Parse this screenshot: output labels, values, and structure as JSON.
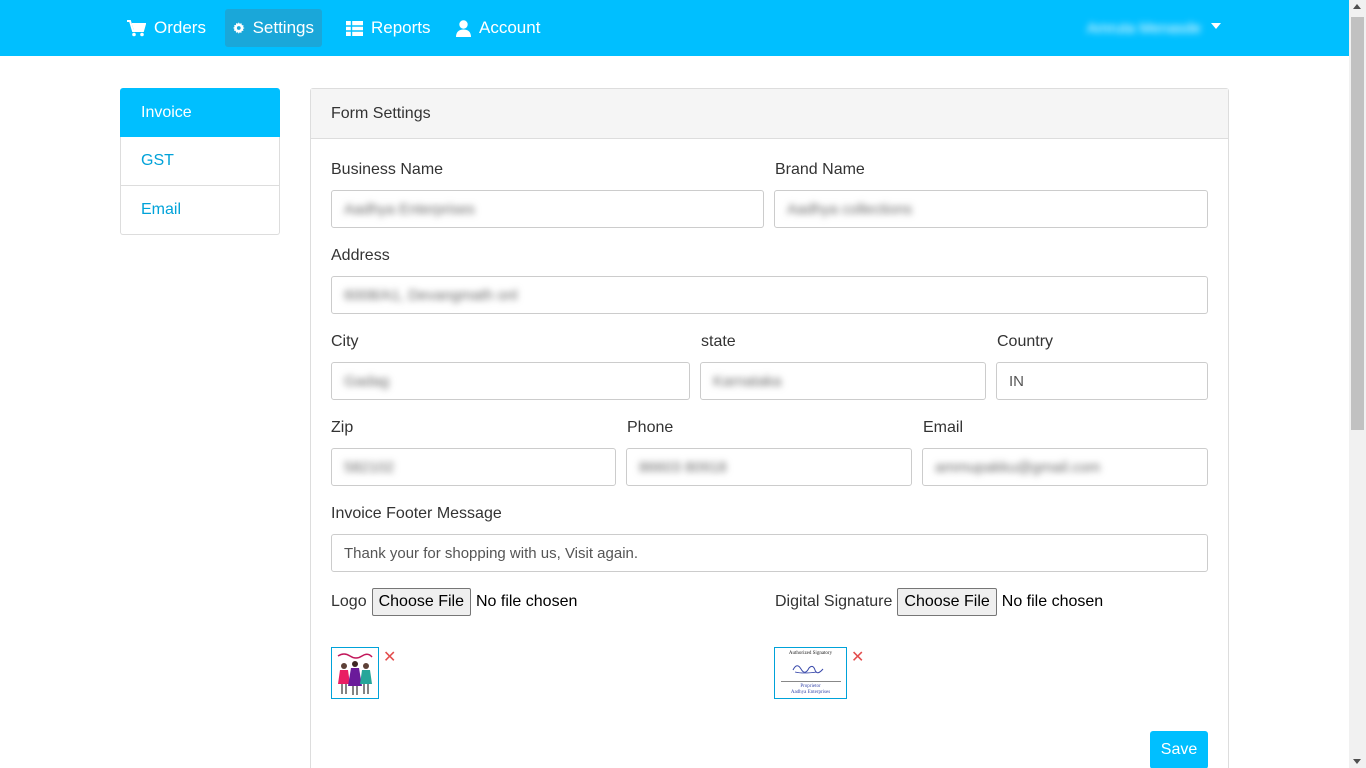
{
  "navbar": {
    "items": [
      {
        "label": "Orders",
        "icon": "cart-icon"
      },
      {
        "label": "Settings",
        "icon": "gear-icon"
      },
      {
        "label": "Reports",
        "icon": "table-icon"
      },
      {
        "label": "Account",
        "icon": "user-icon"
      }
    ],
    "user_name": "Amruta Menasde"
  },
  "sidebar": {
    "items": [
      {
        "label": "Invoice"
      },
      {
        "label": "GST"
      },
      {
        "label": "Email"
      }
    ]
  },
  "panel": {
    "heading": "Form Settings"
  },
  "form": {
    "business_name": {
      "label": "Business Name",
      "value": "Aadhya Enterprises"
    },
    "brand_name": {
      "label": "Brand Name",
      "value": "Aadhya collections"
    },
    "address": {
      "label": "Address",
      "value": "6008/A1, Devangmath onl"
    },
    "city": {
      "label": "City",
      "value": "Gadag"
    },
    "state": {
      "label": "state",
      "value": "Karnataka"
    },
    "country": {
      "label": "Country",
      "value": "IN"
    },
    "zip": {
      "label": "Zip",
      "value": "582102"
    },
    "phone": {
      "label": "Phone",
      "value": "86603 80918"
    },
    "email": {
      "label": "Email",
      "value": "ammupakku@gmail.com"
    },
    "footer_message": {
      "label": "Invoice Footer Message",
      "value": "Thank your for shopping with us, Visit again."
    },
    "logo": {
      "label": "Logo",
      "button": "Choose File",
      "status": "No file chosen"
    },
    "signature": {
      "label": "Digital Signature",
      "button": "Choose File",
      "status": "No file chosen"
    },
    "signature_preview": {
      "line1": "Authorized Signatory",
      "line2": "Proprietor",
      "line3": "Aadhya Enterprises"
    },
    "remove_glyph": "✕",
    "save_label": "Save"
  },
  "colors": {
    "primary": "#00bfff",
    "link": "#00a2d9",
    "remove": "#e34d4d"
  }
}
